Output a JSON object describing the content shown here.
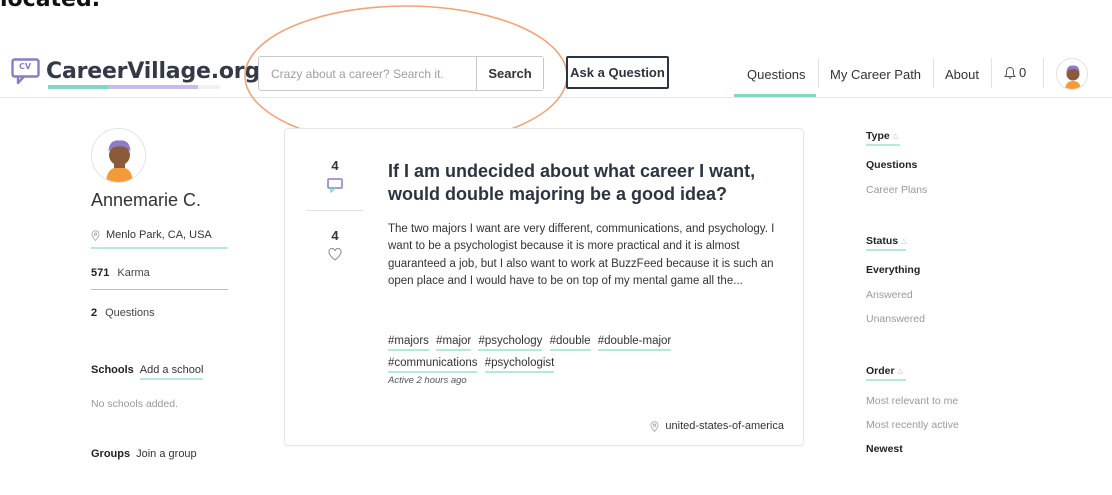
{
  "cropped_heading": "located.",
  "header": {
    "logo_text": "CareerVillage.org",
    "logo_mark_text": "CV",
    "search_placeholder": "Crazy about a career? Search it.",
    "search_button": "Search",
    "ask_button": "Ask a Question",
    "nav": {
      "questions": "Questions",
      "career_path": "My Career Path",
      "about": "About"
    },
    "notifications_count": "0"
  },
  "profile": {
    "name": "Annemarie C.",
    "location": "Menlo Park, CA, USA",
    "karma_value": "571",
    "karma_label": "Karma",
    "questions_value": "2",
    "questions_label": "Questions",
    "schools_label": "Schools",
    "add_school": "Add a school",
    "no_schools": "No schools added.",
    "groups_label": "Groups",
    "join_group": "Join a group"
  },
  "question": {
    "answer_count": "4",
    "like_count": "4",
    "title": "If I am undecided about what career I want, would double majoring be a good idea?",
    "body": "The two majors I want are very different, communications, and psychology. I want to be a psychologist because it is more practical and it is almost guaranteed a job, but I also want to work at BuzzFeed because it is such an open place and I would have to be on top of my mental game all the...",
    "tags": [
      "#majors",
      "#major",
      "#psychology",
      "#double",
      "#double-major",
      "#communications",
      "#psychologist"
    ],
    "active": "Active 2 hours ago",
    "country": "united-states-of-america"
  },
  "filters": {
    "type": {
      "label": "Type",
      "options": [
        "Questions",
        "Career Plans"
      ]
    },
    "status": {
      "label": "Status",
      "options": [
        "Everything",
        "Answered",
        "Unanswered"
      ]
    },
    "order": {
      "label": "Order",
      "options": [
        "Most relevant to me",
        "Most recently active",
        "Newest"
      ]
    }
  },
  "colors": {
    "accent_teal": "#7fd8c4",
    "accent_purple": "#8e7cc3",
    "annotation_orange": "#f0a47a",
    "text_dark": "#2c3442"
  },
  "icons": [
    "logo-speech-bubble-icon",
    "bell-icon",
    "location-pin-icon",
    "answer-bubble-icon",
    "heart-icon",
    "caret-up-icon"
  ]
}
